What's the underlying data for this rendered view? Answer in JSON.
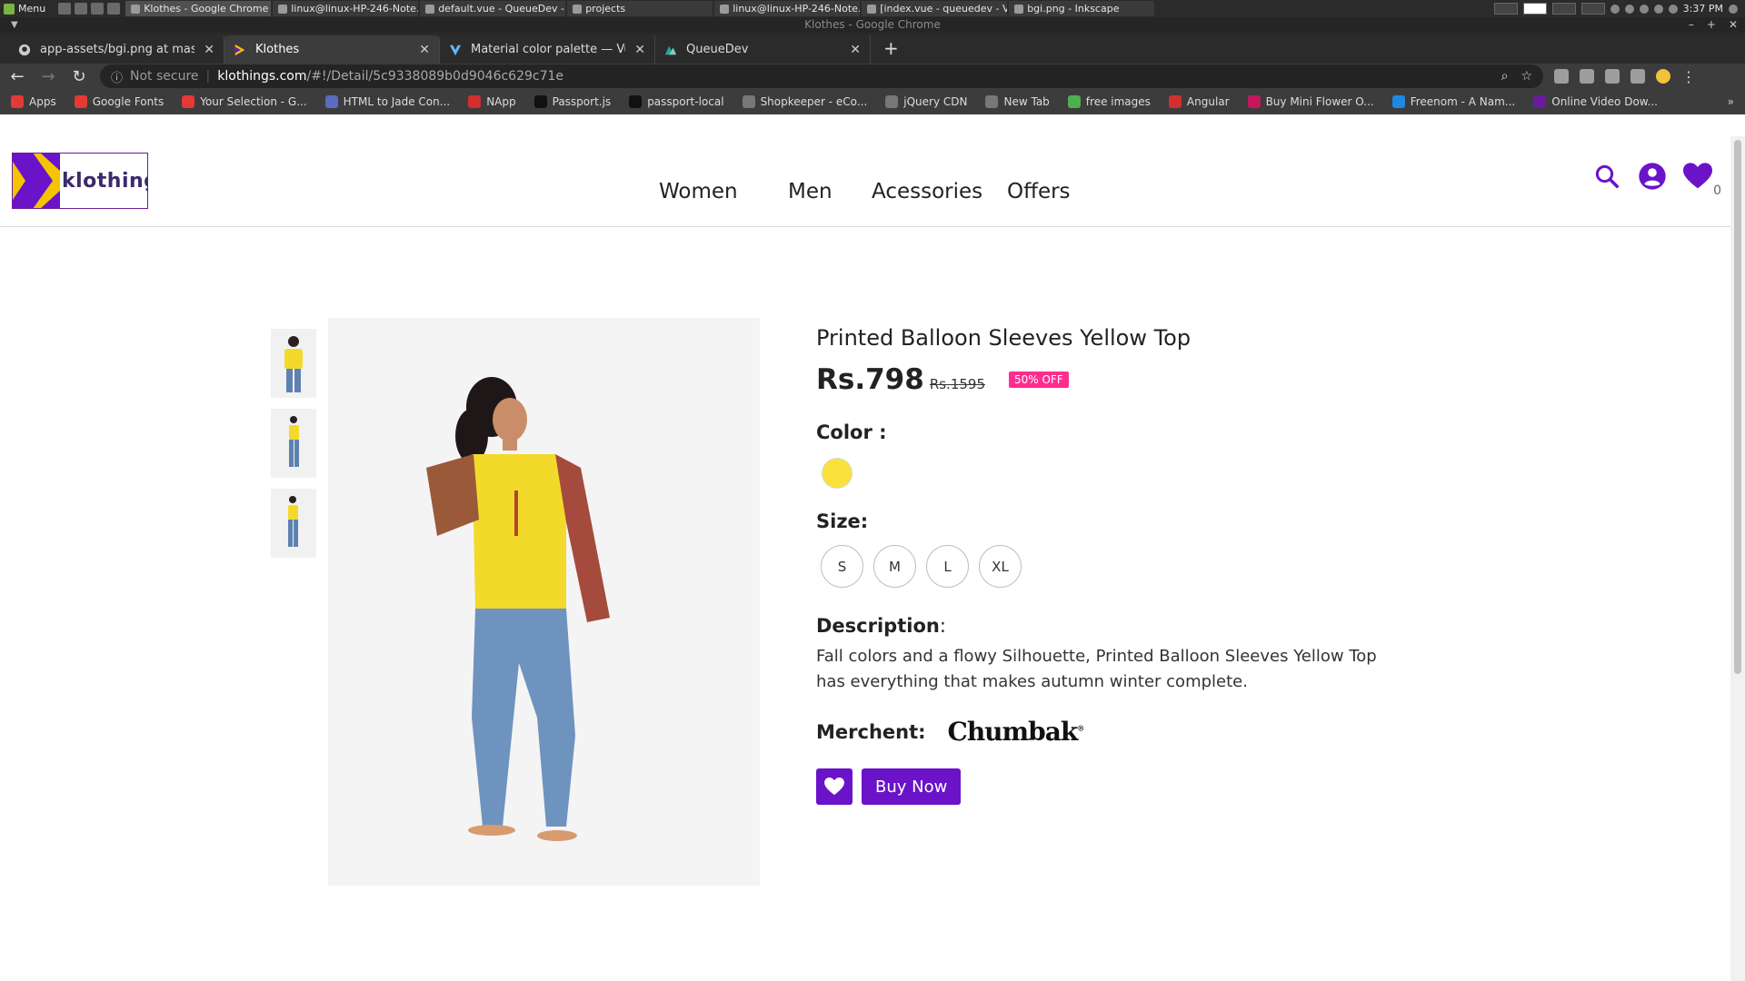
{
  "os": {
    "menu_label": "Menu",
    "windows": [
      "Klothes - Google Chrome",
      "linux@linux-HP-246-Note...",
      "default.vue - QueueDev -...",
      "projects",
      "linux@linux-HP-246-Note...",
      "[index.vue - queuedev - V...",
      "bgi.png - Inkscape"
    ],
    "clock": "3:37 PM"
  },
  "browser": {
    "window_title": "Klothes - Google Chrome",
    "tabs": [
      {
        "label": "app-assets/bgi.png at master ·",
        "icon": "github-icon"
      },
      {
        "label": "Klothes",
        "icon": "klothes-favicon"
      },
      {
        "label": "Material color palette — Vuetify",
        "icon": "vuetify-icon"
      },
      {
        "label": "QueueDev",
        "icon": "queuedev-icon"
      }
    ],
    "address": {
      "security": "Not secure",
      "host": "klothings.com",
      "path": "/#!/Detail/5c9338089b0d9046c629c71e"
    },
    "bookmarks": [
      {
        "label": "Apps",
        "color": "#e53935"
      },
      {
        "label": "Google Fonts",
        "color": "#e53935"
      },
      {
        "label": "Your Selection - G...",
        "color": "#e53935"
      },
      {
        "label": "HTML to Jade Con...",
        "color": "#5c6bc0"
      },
      {
        "label": "NApp",
        "color": "#d32f2f"
      },
      {
        "label": "Passport.js",
        "color": "#111111"
      },
      {
        "label": "passport-local",
        "color": "#111111"
      },
      {
        "label": "Shopkeeper - eCo...",
        "color": "#777777"
      },
      {
        "label": "jQuery CDN",
        "color": "#777777"
      },
      {
        "label": "New Tab",
        "color": "#777777"
      },
      {
        "label": "free images",
        "color": "#4caf50"
      },
      {
        "label": "Angular",
        "color": "#d32f2f"
      },
      {
        "label": "Buy Mini Flower O...",
        "color": "#c2185b"
      },
      {
        "label": "Freenom - A Nam...",
        "color": "#1e88e5"
      },
      {
        "label": "Online Video Dow...",
        "color": "#6a1b9a"
      }
    ],
    "bookmarks_more": "»"
  },
  "site": {
    "logo_text": "klothings",
    "nav": [
      "Women",
      "Men",
      "Acessories",
      "Offers"
    ],
    "cart_count": "0",
    "accent": "#6a13c9"
  },
  "product": {
    "title": "Printed Balloon Sleeves Yellow Top",
    "price": "Rs.798",
    "mrp": "Rs.1595",
    "discount_badge": "50% OFF",
    "color_label": "Color :",
    "color_swatch": "#fae13c",
    "size_label": "Size:",
    "sizes": [
      "S",
      "M",
      "L",
      "XL"
    ],
    "description_label": "Description",
    "description_colon": ":",
    "description": "Fall colors and a flowy Silhouette, Printed Balloon Sleeves Yellow Top has everything that makes autumn winter complete.",
    "merchant_label": "Merchent:",
    "merchant_logo_text": "Chumbak",
    "merchant_logo_mark": "®",
    "buy_label": "Buy Now"
  }
}
